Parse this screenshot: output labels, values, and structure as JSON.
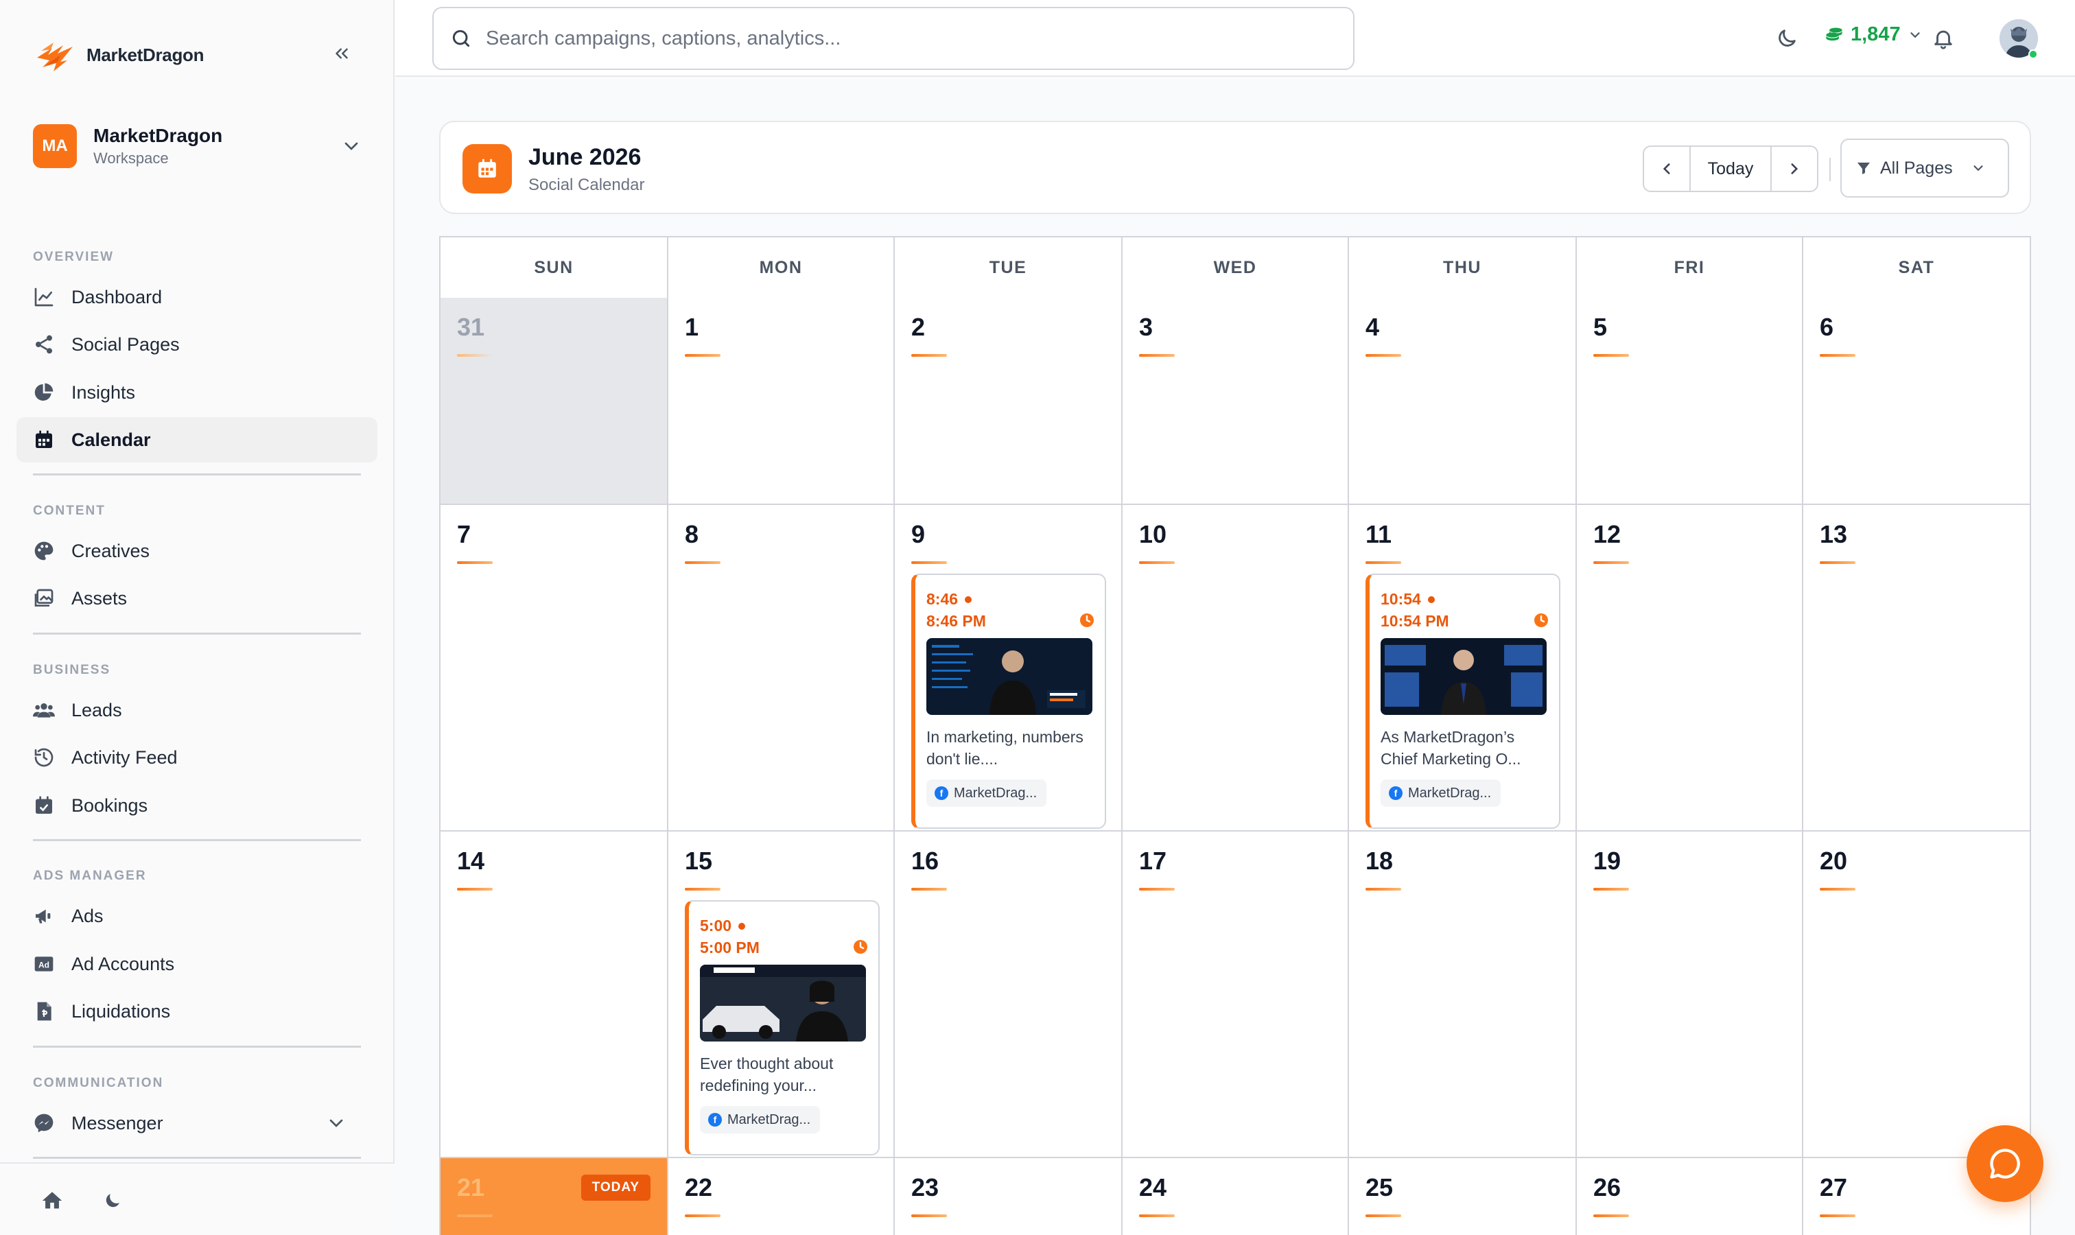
{
  "brand": {
    "name": "MarketDragon"
  },
  "workspace": {
    "initials": "MA",
    "name": "MarketDragon",
    "sub": "Workspace"
  },
  "sidebar": {
    "sections": [
      {
        "label": "OVERVIEW",
        "items": [
          {
            "label": "Dashboard",
            "icon": "chart-line-icon"
          },
          {
            "label": "Social Pages",
            "icon": "share-icon"
          },
          {
            "label": "Insights",
            "icon": "pie-chart-icon"
          },
          {
            "label": "Calendar",
            "icon": "calendar-icon",
            "active": true
          }
        ]
      },
      {
        "label": "CONTENT",
        "items": [
          {
            "label": "Creatives",
            "icon": "palette-icon"
          },
          {
            "label": "Assets",
            "icon": "images-icon"
          }
        ]
      },
      {
        "label": "BUSINESS",
        "items": [
          {
            "label": "Leads",
            "icon": "users-icon"
          },
          {
            "label": "Activity Feed",
            "icon": "history-icon"
          },
          {
            "label": "Bookings",
            "icon": "calendar-check-icon"
          }
        ]
      },
      {
        "label": "ADS MANAGER",
        "items": [
          {
            "label": "Ads",
            "icon": "megaphone-icon"
          },
          {
            "label": "Ad Accounts",
            "icon": "ad-icon"
          },
          {
            "label": "Liquidations",
            "icon": "invoice-icon"
          }
        ]
      },
      {
        "label": "COMMUNICATION",
        "items": [
          {
            "label": "Messenger",
            "icon": "messenger-icon"
          }
        ]
      }
    ]
  },
  "topbar": {
    "search_placeholder": "Search campaigns, captions, analytics...",
    "credits": "1,847"
  },
  "calendar": {
    "title": "June 2026",
    "subtitle": "Social Calendar",
    "today_label": "Today",
    "filter_label": "All Pages",
    "weekdays": [
      "SUN",
      "MON",
      "TUE",
      "WED",
      "THU",
      "FRI",
      "SAT"
    ],
    "today_badge": "TODAY",
    "weeks": [
      [
        "31",
        "1",
        "2",
        "3",
        "4",
        "5",
        "6"
      ],
      [
        "7",
        "8",
        "9",
        "10",
        "11",
        "12",
        "13"
      ],
      [
        "14",
        "15",
        "16",
        "17",
        "18",
        "19",
        "20"
      ],
      [
        "21",
        "22",
        "23",
        "24",
        "25",
        "26",
        "27"
      ]
    ],
    "posts": [
      {
        "time_short": "8:46",
        "time_full": "8:46 PM",
        "caption": "In marketing, numbers don't lie....",
        "page": "MarketDrag..."
      },
      {
        "time_short": "10:54",
        "time_full": "10:54 PM",
        "caption": "As MarketDragon’s Chief Marketing O...",
        "page": "MarketDrag..."
      },
      {
        "time_short": "5:00",
        "time_full": "5:00 PM",
        "caption": "Ever thought about redefining your...",
        "page": "MarketDrag..."
      }
    ]
  },
  "colors": {
    "accent": "#f97316",
    "credits": "#16a34a",
    "facebook": "#1877f2"
  }
}
